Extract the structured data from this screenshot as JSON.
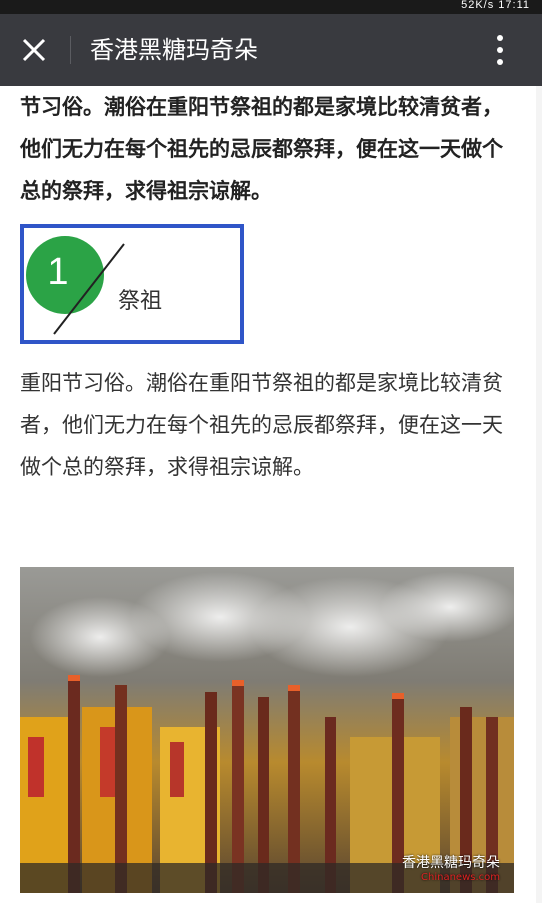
{
  "status_bar": {
    "text": "52K/s 17:11"
  },
  "header": {
    "title": "香港黑糖玛奇朵",
    "close_icon": "close-icon",
    "more_icon": "more-vertical-icon",
    "background": "#393a3f"
  },
  "article": {
    "bold_paragraph": "节习俗。潮俗在重阳节祭祖的都是家境比较清贫者，他们无力在每个祖先的忌辰都祭拜，便在这一天做个总的祭拜，求得祖宗谅解。",
    "section_label": {
      "number": "1",
      "text": "祭祖",
      "border_color": "#2f55c8",
      "circle_color": "#2ba346"
    },
    "paragraph": "重阳节习俗。潮俗在重阳节祭祖的都是家境比较清贫者，他们无力在每个祖先的忌辰都祭拜，便在这一天做个总的祭拜，求得祖宗谅解。",
    "photo": {
      "watermark": "香港黑糖玛奇朵",
      "watermark_site": "Chinanews.com"
    }
  }
}
